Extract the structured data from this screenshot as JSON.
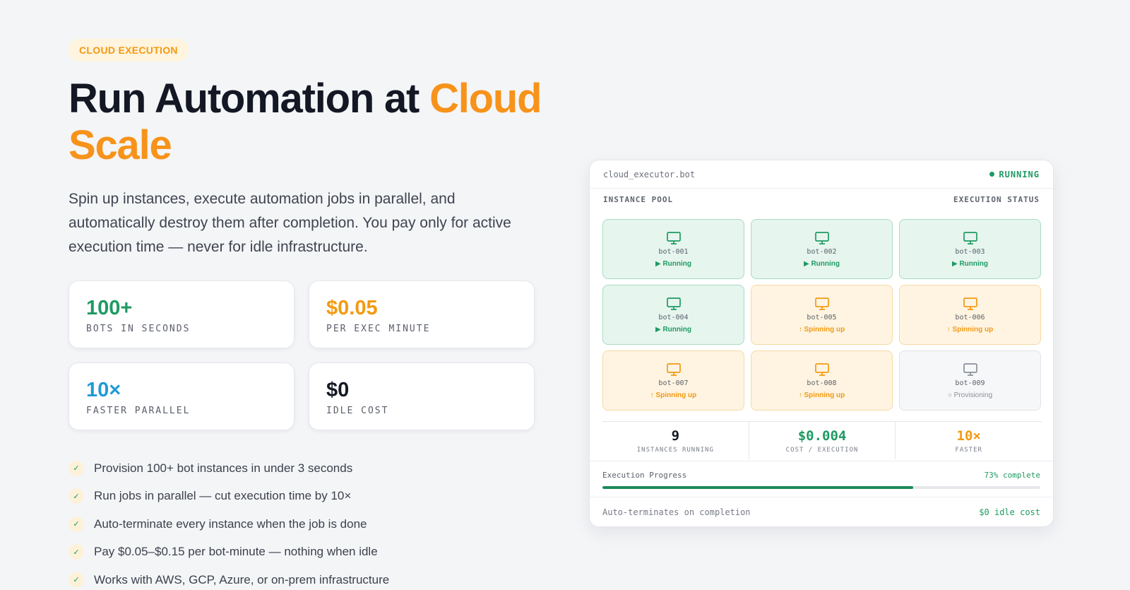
{
  "badge": "CLOUD EXECUTION",
  "headline": {
    "lead": "Run Automation at ",
    "accent": "Cloud Scale"
  },
  "lede": "Spin up instances, execute automation jobs in parallel, and automatically destroy them after completion. You pay only for active execution time — never for idle infrastructure.",
  "stats": [
    {
      "value": "100+",
      "label": "BOTS IN SECONDS",
      "color": "#1e9a62"
    },
    {
      "value": "$0.05",
      "label": "PER EXEC MINUTE",
      "color": "#f39a12"
    },
    {
      "value": "10×",
      "label": "FASTER PARALLEL",
      "color": "#1f9bd7"
    },
    {
      "value": "$0",
      "label": "IDLE COST",
      "color": "#141824"
    }
  ],
  "features": [
    "Provision 100+ bot instances in under 3 seconds",
    "Run jobs in parallel — cut execution time by 10×",
    "Auto-terminate every instance when the job is done",
    "Pay $0.05–$0.15 per bot-minute — nothing when idle",
    "Works with AWS, GCP, Azure, or on-prem infrastructure"
  ],
  "panel": {
    "file": "cloud_executor.bot",
    "status": "RUNNING",
    "pool_label": "INSTANCE POOL",
    "status_label": "EXECUTION STATUS",
    "bots": [
      {
        "name": "bot-001",
        "state": "▶ Running",
        "kind": "running"
      },
      {
        "name": "bot-002",
        "state": "▶ Running",
        "kind": "running"
      },
      {
        "name": "bot-003",
        "state": "▶ Running",
        "kind": "running"
      },
      {
        "name": "bot-004",
        "state": "▶ Running",
        "kind": "running"
      },
      {
        "name": "bot-005",
        "state": "↑ Spinning up",
        "kind": "spinning"
      },
      {
        "name": "bot-006",
        "state": "↑ Spinning up",
        "kind": "spinning"
      },
      {
        "name": "bot-007",
        "state": "↑ Spinning up",
        "kind": "spinning"
      },
      {
        "name": "bot-008",
        "state": "↑ Spinning up",
        "kind": "spinning"
      },
      {
        "name": "bot-009",
        "state": "○ Provisioning",
        "kind": "provisioning"
      }
    ],
    "metrics": [
      {
        "value": "9",
        "label": "INSTANCES RUNNING",
        "color": "#141824"
      },
      {
        "value": "$0.004",
        "label": "COST / EXECUTION",
        "color": "#1e9a62"
      },
      {
        "value": "10×",
        "label": "FASTER",
        "color": "#f39a12"
      }
    ],
    "progress": {
      "label": "Execution Progress",
      "pct_text": "73% complete",
      "fraction": 0.71
    },
    "footer": {
      "left": "Auto-terminates on completion",
      "right": "$0 idle cost"
    }
  },
  "colors": {
    "running": "#1e9a62",
    "spinning": "#f39a12",
    "provisioning": "#8b9099"
  }
}
